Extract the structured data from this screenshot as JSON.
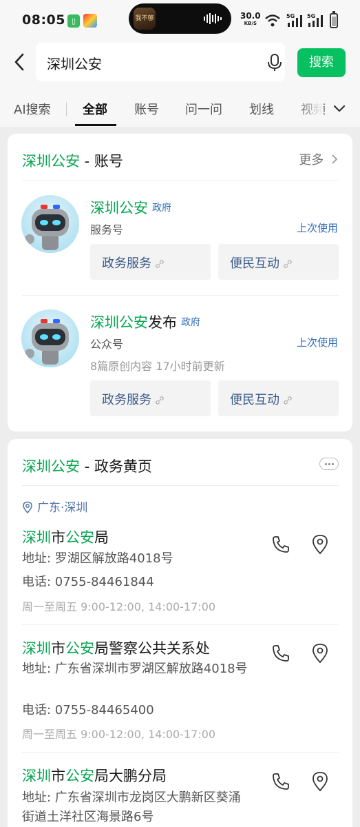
{
  "status_bar": {
    "time": "08:05",
    "net_speed": "30.0",
    "net_unit": "KB/S",
    "network_1": "5G",
    "network_2": "5G",
    "island_art_text": "我不够"
  },
  "search": {
    "query": "深圳公安",
    "button_label": "搜索"
  },
  "tabs": [
    {
      "label": "AI搜索"
    },
    {
      "label": "全部"
    },
    {
      "label": "账号"
    },
    {
      "label": "问一问"
    },
    {
      "label": "划线"
    },
    {
      "label": "视频"
    }
  ],
  "accounts_card": {
    "title_keyword": "深圳公安",
    "title_suffix": " - 账号",
    "more_label": "更多",
    "accounts": [
      {
        "name_highlight": "深圳公安",
        "name_rest": "",
        "tag": "政府",
        "type": "服务号",
        "last_used": "上次使用",
        "meta": "",
        "services": [
          "政务服务",
          "便民互动"
        ]
      },
      {
        "name_highlight": "深圳公安",
        "name_rest": "发布",
        "tag": "政府",
        "type": "公众号",
        "last_used": "上次使用",
        "meta": "8篇原创内容  17小时前更新",
        "services": [
          "政务服务",
          "便民互动"
        ]
      }
    ]
  },
  "yellow_pages_card": {
    "title_keyword": "深圳公安",
    "title_suffix": " - 政务黄页",
    "location": "广东·深圳",
    "entries": [
      {
        "t1": "深圳",
        "t2": "市",
        "t3": "公安",
        "t4": "局",
        "address": "地址: 罗湖区解放路4018号",
        "phone": "电话: 0755-84461844",
        "hours": "周一至周五 9:00-12:00, 14:00-17:00"
      },
      {
        "t1": "深圳",
        "t2": "市",
        "t3": "公安",
        "t4": "局警察公共关系处",
        "address": "地址: 广东省深圳市罗湖区解放路4018号",
        "phone": "电话: 0755-84465400",
        "hours": "周一至周五 9:00-12:00, 14:00-17:00"
      },
      {
        "t1": "深圳",
        "t2": "市",
        "t3": "公安",
        "t4": "局大鹏分局",
        "address": "地址: 广东省深圳市龙岗区大鹏新区葵涌街道土洋社区海景路6号",
        "phone": "",
        "hours": ""
      }
    ]
  }
}
